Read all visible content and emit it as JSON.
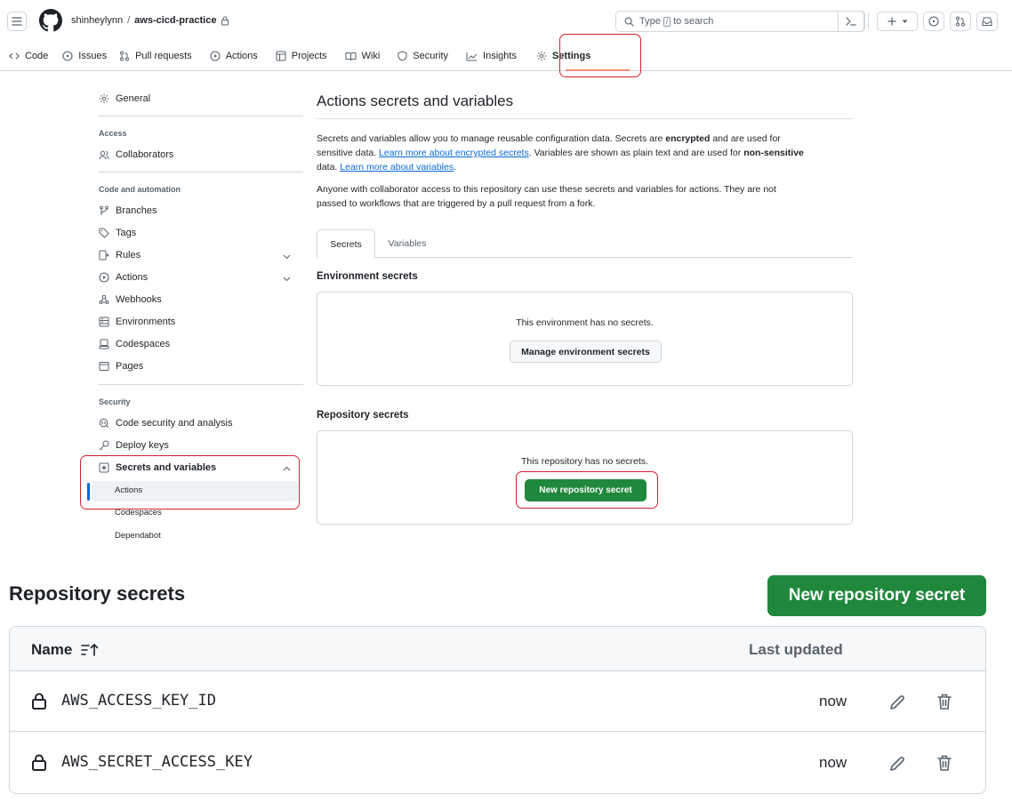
{
  "header": {
    "owner": "shinheylynn",
    "separator": "/",
    "repo": "aws-cicd-practice",
    "search_prefix": "Type",
    "search_key": "/",
    "search_suffix": "to search"
  },
  "nav": {
    "code": "Code",
    "issues": "Issues",
    "pulls": "Pull requests",
    "actions": "Actions",
    "projects": "Projects",
    "wiki": "Wiki",
    "security": "Security",
    "insights": "Insights",
    "settings": "Settings"
  },
  "sidebar": {
    "general": "General",
    "access_head": "Access",
    "collaborators": "Collaborators",
    "code_head": "Code and automation",
    "branches": "Branches",
    "tags": "Tags",
    "rules": "Rules",
    "actions": "Actions",
    "webhooks": "Webhooks",
    "environments": "Environments",
    "codespaces": "Codespaces",
    "pages": "Pages",
    "security_head": "Security",
    "code_security": "Code security and analysis",
    "deploy_keys": "Deploy keys",
    "secrets_vars": "Secrets and variables",
    "sub_actions": "Actions",
    "sub_codespaces": "Codespaces",
    "sub_dependabot": "Dependabot"
  },
  "main": {
    "title": "Actions secrets and variables",
    "p1_a": "Secrets and variables allow you to manage reusable configuration data. Secrets are ",
    "p1_b": "encrypted",
    "p1_c": " and are used for",
    "p1_d": "sensitive data. ",
    "p1_link1": "Learn more about encrypted secrets",
    "p1_e": ". Variables are shown as plain text and are used for ",
    "p1_f": "non-sensitive",
    "p1_g": "data. ",
    "p1_link2": "Learn more about variables",
    "p1_h": ".",
    "p2_line1": "Anyone with collaborator access to this repository can use these secrets and variables for actions. They are not",
    "p2_line2": "passed to workflows that are triggered by a pull request from a fork.",
    "tab_secrets": "Secrets",
    "tab_variables": "Variables",
    "env_title": "Environment secrets",
    "env_msg": "This environment has no secrets.",
    "env_btn": "Manage environment secrets",
    "repo_title": "Repository secrets",
    "repo_msg": "This repository has no secrets.",
    "repo_btn": "New repository secret"
  },
  "zoom": {
    "title": "Repository secrets",
    "new_btn": "New repository secret",
    "col_name": "Name",
    "col_updated": "Last updated",
    "rows": [
      {
        "name": "AWS_ACCESS_KEY_ID",
        "updated": "now"
      },
      {
        "name": "AWS_SECRET_ACCESS_KEY",
        "updated": "now"
      }
    ]
  },
  "colors": {
    "highlight": "#d1242f",
    "primary_button": "#1f883d",
    "link": "#0969da",
    "active_marker": "#0969da"
  }
}
